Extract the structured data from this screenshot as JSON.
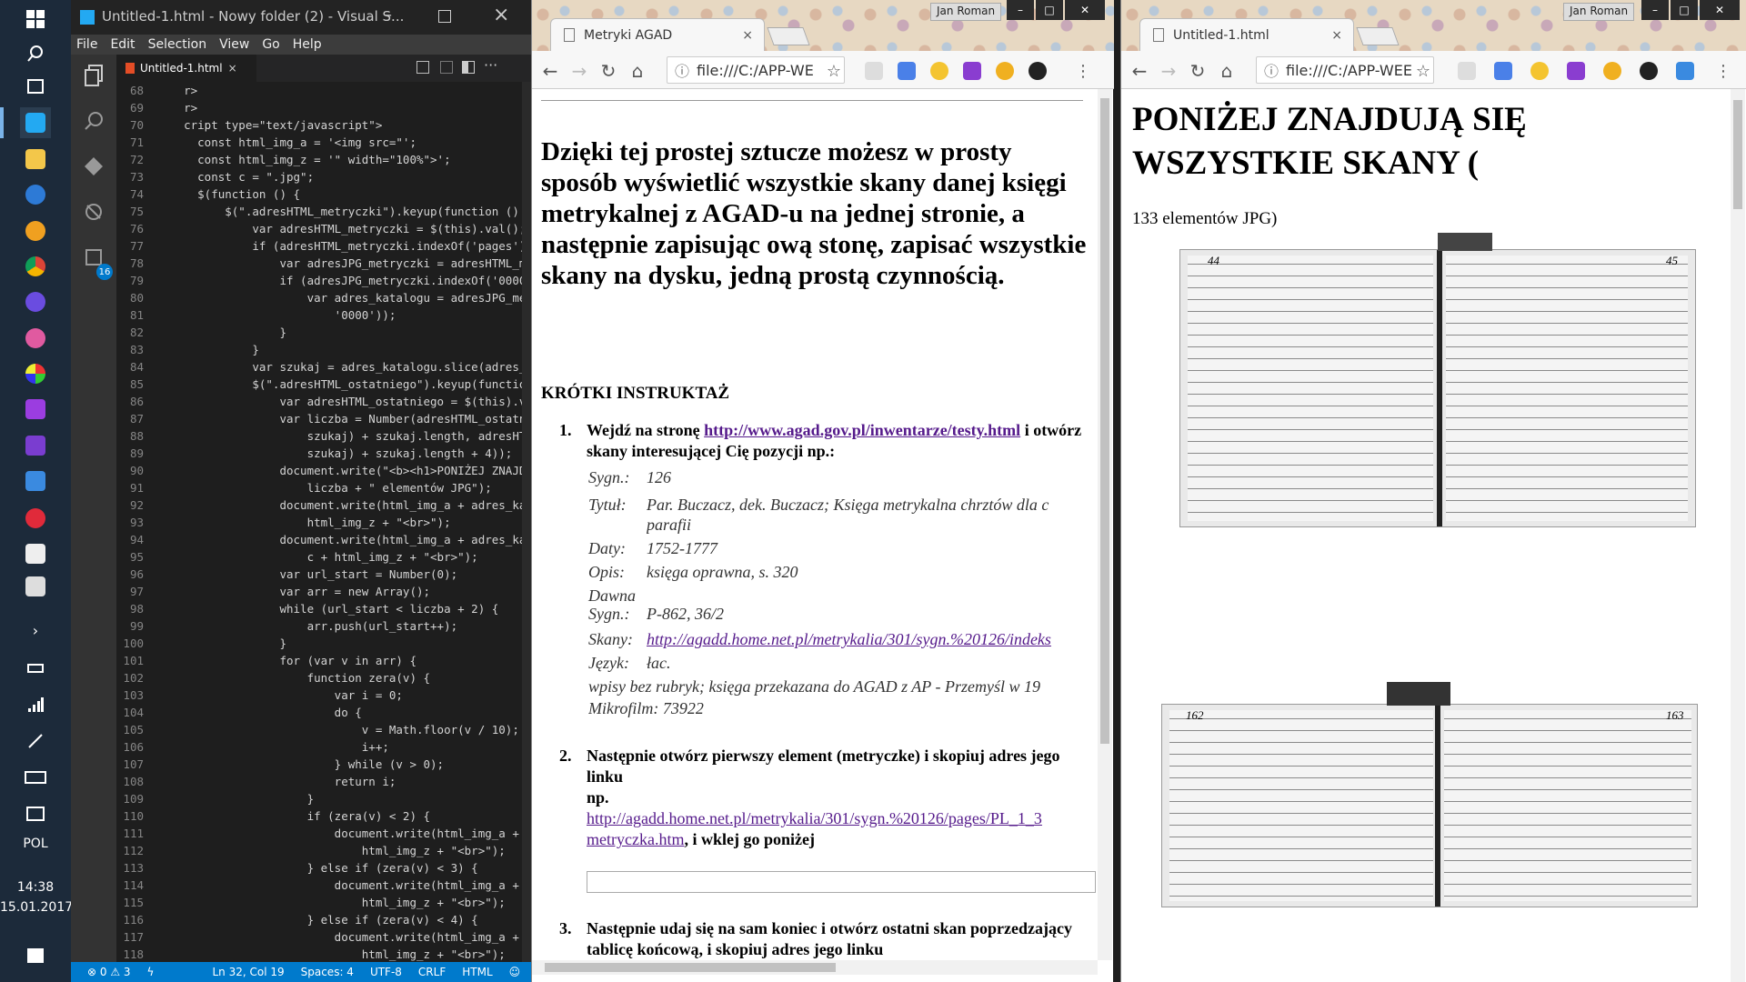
{
  "taskbar": {
    "language": "POL",
    "time": "14:38",
    "date": "15.01.2017"
  },
  "vscode": {
    "title": "Untitled-1.html - Nowy folder (2) - Visual S...",
    "menu": [
      "File",
      "Edit",
      "Selection",
      "View",
      "Go",
      "Help"
    ],
    "tab_label": "Untitled-1.html",
    "extensions_badge": "16",
    "code_lines": [
      {
        "n": "68",
        "t": "    r>"
      },
      {
        "n": "69",
        "t": "    r>"
      },
      {
        "n": "70",
        "t": "    cript type=\"text/javascript\">"
      },
      {
        "n": "71",
        "t": "      const html_img_a = '<img src=\"';"
      },
      {
        "n": "72",
        "t": "      const html_img_z = '\" width=\"100%\">';"
      },
      {
        "n": "73",
        "t": "      const c = \".jpg\";"
      },
      {
        "n": "74",
        "t": "      $(function () {"
      },
      {
        "n": "75",
        "t": "          $(\".adresHTML_metryczki\").keyup(function ()"
      },
      {
        "n": "76",
        "t": "              var adresHTML_metryczki = $(this).val();"
      },
      {
        "n": "77",
        "t": "              if (adresHTML_metryczki.indexOf('pages')"
      },
      {
        "n": "78",
        "t": "                  var adresJPG_metryczki = adresHTML_me"
      },
      {
        "n": "79",
        "t": "                  if (adresJPG_metryczki.indexOf('0000"
      },
      {
        "n": "80",
        "t": "                      var adres_katalogu = adresJPG_me"
      },
      {
        "n": "81",
        "t": "                          '0000'));"
      },
      {
        "n": "82",
        "t": "                  }"
      },
      {
        "n": "83",
        "t": "              }"
      },
      {
        "n": "84",
        "t": "              var szukaj = adres_katalogu.slice(adres_"
      },
      {
        "n": "85",
        "t": "              $(\".adresHTML_ostatniego\").keyup(functio"
      },
      {
        "n": "86",
        "t": "                  var adresHTML_ostatniego = $(this).v"
      },
      {
        "n": "87",
        "t": "                  var liczba = Number(adresHTML_ostatn"
      },
      {
        "n": "88",
        "t": "                      szukaj) + szukaj.length, adresHT"
      },
      {
        "n": "89",
        "t": "                      szukaj) + szukaj.length + 4));"
      },
      {
        "n": "90",
        "t": "                  document.write(\"<b><h1>PONIŻEJ ZNAJD"
      },
      {
        "n": "91",
        "t": "                      liczba + \" elementów JPG\");"
      },
      {
        "n": "92",
        "t": "                  document.write(html_img_a + adres_ka"
      },
      {
        "n": "93",
        "t": "                      html_img_z + \"<br>\");"
      },
      {
        "n": "94",
        "t": "                  document.write(html_img_a + adres_ka"
      },
      {
        "n": "95",
        "t": "                      c + html_img_z + \"<br>\");"
      },
      {
        "n": "96",
        "t": "                  var url_start = Number(0);"
      },
      {
        "n": "97",
        "t": "                  var arr = new Array();"
      },
      {
        "n": "98",
        "t": "                  while (url_start < liczba + 2) {"
      },
      {
        "n": "99",
        "t": "                      arr.push(url_start++);"
      },
      {
        "n": "100",
        "t": "                  }"
      },
      {
        "n": "101",
        "t": "                  for (var v in arr) {"
      },
      {
        "n": "102",
        "t": "                      function zera(v) {"
      },
      {
        "n": "103",
        "t": "                          var i = 0;"
      },
      {
        "n": "104",
        "t": "                          do {"
      },
      {
        "n": "105",
        "t": "                              v = Math.floor(v / 10);"
      },
      {
        "n": "106",
        "t": "                              i++;"
      },
      {
        "n": "107",
        "t": "                          } while (v > 0);"
      },
      {
        "n": "108",
        "t": "                          return i;"
      },
      {
        "n": "109",
        "t": "                      }"
      },
      {
        "n": "110",
        "t": "                      if (zera(v) < 2) {"
      },
      {
        "n": "111",
        "t": "                          document.write(html_img_a +"
      },
      {
        "n": "112",
        "t": "                              html_img_z + \"<br>\");"
      },
      {
        "n": "113",
        "t": "                      } else if (zera(v) < 3) {"
      },
      {
        "n": "114",
        "t": "                          document.write(html_img_a +"
      },
      {
        "n": "115",
        "t": "                              html_img_z + \"<br>\");"
      },
      {
        "n": "116",
        "t": "                      } else if (zera(v) < 4) {"
      },
      {
        "n": "117",
        "t": "                          document.write(html_img_a +"
      },
      {
        "n": "118",
        "t": "                              html_img_z + \"<br>\");"
      }
    ],
    "status": {
      "errors": "0",
      "warnings": "3",
      "position": "Ln 32, Col 19",
      "spaces": "Spaces: 4",
      "encoding": "UTF-8",
      "eol": "CRLF",
      "language": "HTML"
    }
  },
  "chrome_left": {
    "user": "Jan Roman",
    "tab_title": "Metryki AGAD",
    "address": "file:///C:/APP-WE",
    "intro": "Dzięki tej prostej sztucze możesz w prosty sposób wyświetlić wszystkie skany danej księgi metrykalnej z AGAD-u na jednej stronie, a następnie zapisując ową stonę, zapisać wszystkie skany na dysku, jedną prostą czynnością.",
    "section_title": "KRÓTKI INSTRUKTAŻ",
    "step1_prefix": "Wejdź na stronę ",
    "step1_link": "http://www.agad.gov.pl/inwentarze/testy.html",
    "step1_suffix": " i otwórz skany interesującej Cię pozycji np.:",
    "meta": [
      {
        "k": "Sygn.:",
        "v": "126"
      },
      {
        "k": "Tytuł:",
        "v": "Par. Buczacz, dek. Buczacz; Księga metrykalna chrztów dla c"
      },
      {
        "k": "",
        "v": "parafii"
      },
      {
        "k": "Daty:",
        "v": "1752-1777"
      },
      {
        "k": "Opis:",
        "v": "księga oprawna, s. 320"
      },
      {
        "k": "Dawna",
        "v": ""
      },
      {
        "k": "Sygn.:",
        "v": "P-862, 36/2"
      },
      {
        "k": "Skany:",
        "v": "http://agadd.home.net.pl/metrykalia/301/sygn.%20126/indeks"
      },
      {
        "k": "Język:",
        "v": "łac."
      }
    ],
    "meta_note": "wpisy bez rubryk; księga przekazana do AGAD z AP - Przemyśl w 19",
    "meta_microfilm": "Mikrofilm: 73922",
    "step2_text": "Następnie otwórz pierwszy element (metryczke) i skopiuj adres jego linku",
    "step2_np": "np.",
    "step2_link_a": "http://agadd.home.net.pl/metrykalia/301/sygn.%20126/pages/PL_1_3",
    "step2_link_b": "metryczka.htm",
    "step2_suffix": ", i wklej go poniżej",
    "step3_text": "Następnie udaj się na sam koniec i otwórz ostatni skan poprzedzający tablicę końcową, i skopiuj adres jego linku"
  },
  "chrome_right": {
    "user": "Jan Roman",
    "tab_title": "Untitled-1.html",
    "address": "file:///C:/APP-WEE",
    "heading": "PONIŻEJ ZNAJDUJĄ SIĘ WSZYSTKIE SKANY (",
    "count_text": "133 elementów JPG)",
    "scan1_page_left": "44",
    "scan1_page_right": "45",
    "scan2_page_left": "162",
    "scan2_page_right": "163"
  }
}
